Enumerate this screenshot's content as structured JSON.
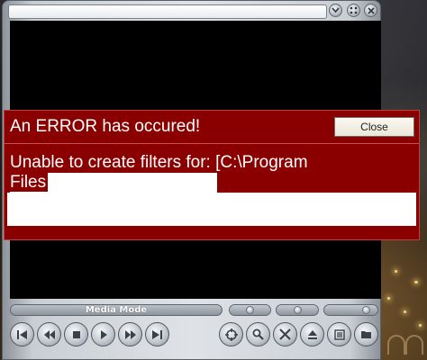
{
  "player": {
    "title_text": "",
    "mode_label": "Media Mode"
  },
  "window_buttons": [
    {
      "name": "minimize",
      "icon": "chevron-down-icon"
    },
    {
      "name": "options",
      "icon": "dots-icon"
    },
    {
      "name": "close",
      "icon": "close-icon"
    }
  ],
  "transport_buttons": [
    {
      "name": "skip-back",
      "icon": "skip-back-icon"
    },
    {
      "name": "rewind",
      "icon": "rewind-icon"
    },
    {
      "name": "stop",
      "icon": "stop-icon"
    },
    {
      "name": "play",
      "icon": "play-icon"
    },
    {
      "name": "fast-forward",
      "icon": "fast-forward-icon"
    },
    {
      "name": "skip-forward",
      "icon": "skip-forward-icon"
    }
  ],
  "tool_buttons": [
    {
      "name": "fullscreen",
      "icon": "target-icon"
    },
    {
      "name": "zoom",
      "icon": "magnifier-icon"
    },
    {
      "name": "settings",
      "icon": "tools-icon"
    },
    {
      "name": "eject",
      "icon": "eject-icon"
    },
    {
      "name": "playlist",
      "icon": "playlist-icon"
    },
    {
      "name": "folder",
      "icon": "folder-icon"
    }
  ],
  "error": {
    "title": "An ERROR has occured!",
    "close_label": "Close",
    "message_line1": "Unable to create filters for: [C:\\Program",
    "message_line2": "Files",
    "detail_text": ""
  },
  "colors": {
    "error_background": "#8a0000",
    "video_background": "#000000"
  }
}
